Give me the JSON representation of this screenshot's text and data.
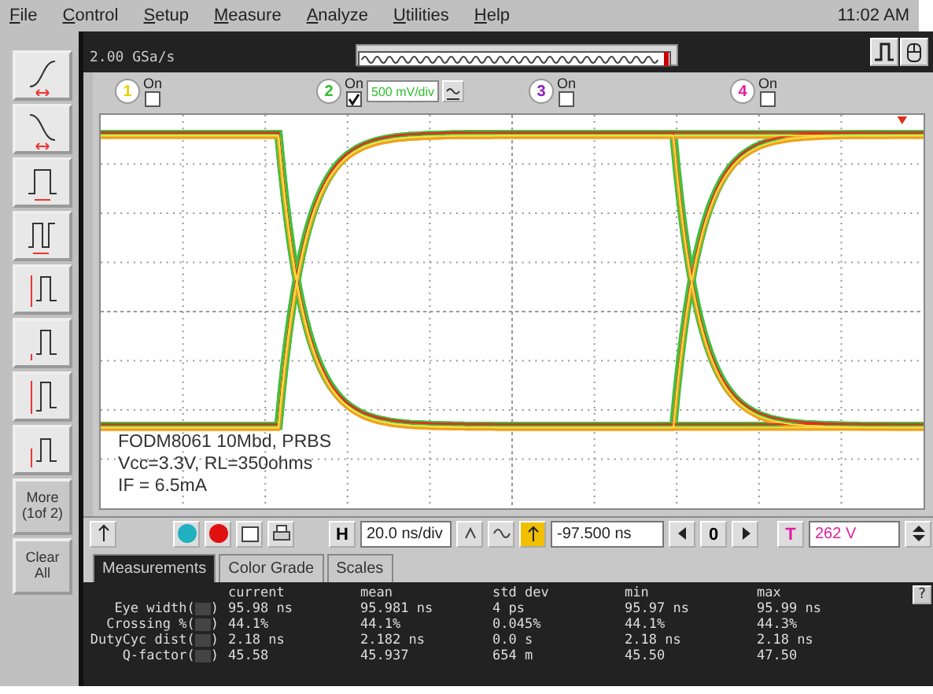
{
  "menu": [
    {
      "label": "File"
    },
    {
      "label": "Control"
    },
    {
      "label": "Setup"
    },
    {
      "label": "Measure"
    },
    {
      "label": "Analyze"
    },
    {
      "label": "Utilities"
    },
    {
      "label": "Help"
    }
  ],
  "clock": "11:02 AM",
  "sample_rate": "2.00 GSa/s",
  "sidebar_buttons": [
    {
      "label": "More\n(1of 2)"
    },
    {
      "label": "Clear\nAll"
    }
  ],
  "channels": [
    {
      "number": "1",
      "label": "On",
      "checked": false,
      "color": "#e8d000"
    },
    {
      "number": "2",
      "label": "On",
      "checked": true,
      "color": "#30c030",
      "scale": "500 mV/div"
    },
    {
      "number": "3",
      "label": "On",
      "checked": false,
      "color": "#9020c0"
    },
    {
      "number": "4",
      "label": "On",
      "checked": false,
      "color": "#e020a0"
    }
  ],
  "annotation": [
    "FODM8061 10Mbd, PRBS",
    "Vcc=3.3V, RL=350ohms",
    "IF = 6.5mA"
  ],
  "controls": {
    "timebase_button": "H",
    "timebase": "20.0 ns/div",
    "delay": "-97.500 ns",
    "delay_zero": "0",
    "trigger_button": "T",
    "trigger_level": "262 V"
  },
  "tabs": [
    {
      "label": "Measurements",
      "selected": true
    },
    {
      "label": "Color Grade",
      "selected": false
    },
    {
      "label": "Scales",
      "selected": false
    }
  ],
  "measurements": {
    "columns": [
      "current",
      "mean",
      "std dev",
      "min",
      "max"
    ],
    "help": "?",
    "rows": [
      {
        "label": "Eye width(",
        "label_end": ")",
        "values": [
          "95.98 ns",
          "95.981 ns",
          "4 ps",
          "95.97 ns",
          "95.99 ns"
        ]
      },
      {
        "label": "Crossing %(",
        "label_end": ")",
        "values": [
          "44.1%",
          "44.1%",
          "0.045%",
          "44.1%",
          "44.3%"
        ]
      },
      {
        "label": "DutyCyc dist(",
        "label_end": ")",
        "values": [
          "2.18 ns",
          "2.182 ns",
          "0.0 s",
          "2.18 ns",
          "2.18 ns"
        ]
      },
      {
        "label": "Q-factor(",
        "label_end": ")",
        "values": [
          "45.58",
          "45.937",
          "654 m",
          "45.50",
          "47.50"
        ]
      }
    ]
  }
}
